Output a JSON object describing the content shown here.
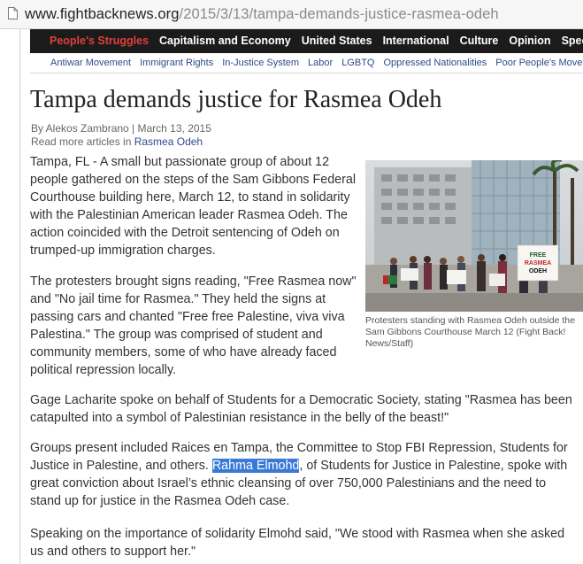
{
  "browser": {
    "url_host": "www.fightbacknews.org",
    "url_path": "/2015/3/13/tampa-demands-justice-rasmea-odeh"
  },
  "nav": {
    "primary": [
      "People's Struggles",
      "Capitalism and Economy",
      "United States",
      "International",
      "Culture",
      "Opinion",
      "Special Co"
    ],
    "active_index": 0,
    "secondary": [
      "Antiwar Movement",
      "Immigrant Rights",
      "In-Justice System",
      "Labor",
      "LGBTQ",
      "Oppressed Nationalities",
      "Poor People's Move"
    ]
  },
  "article": {
    "title": "Tampa demands justice for Rasmea Odeh",
    "byline": "By Alekos Zambrano | March 13, 2015",
    "read_more_prefix": "Read more articles in ",
    "read_more_link": "Rasmea Odeh",
    "paragraphs": [
      "Tampa, FL - A small but passionate group of about 12 people gathered on the steps of the Sam Gibbons Federal Courthouse building here, March 12, to stand in solidarity with the Palestinian American leader Rasmea Odeh. The action coincided with the Detroit sentencing of Odeh on trumped-up immigration charges.",
      "The protesters brought signs reading, \"Free Rasmea now\" and \"No jail time for Rasmea.\" They held the signs at passing cars and chanted \"Free free Palestine, viva viva Palestina.\" The group was comprised of student and community members, some of who have already faced political repression locally.",
      "Gage Lacharite spoke on behalf of Students for a Democratic Society, stating \"Rasmea has been catapulted into a symbol of Palestinian resistance in the belly of the beast!\""
    ],
    "para4_before": "Groups present included Raices en Tampa, the Committee to Stop FBI Repression, Students for Justice in Palestine, and others. ",
    "para4_highlight": "Rahma Elmohd",
    "para4_after": ", of Students for Justice in Palestine, spoke with great conviction about Israel’s ethnic cleansing of over 750,000 Palestinians and the need to stand up for justice in the Rasmea Odeh case.",
    "para5": "Speaking on the importance of solidarity Elmohd said, \"We stood with Rasmea when she asked us and others to support her.\"",
    "photo": {
      "caption": "Protesters standing with Rasmea Odeh outside the Sam Gibbons Courthouse March 12 (Fight Back! News/Staff)",
      "sign_1": "FREE RASMEA ODEH"
    }
  },
  "colors": {
    "nav_bg": "#1b1b1b",
    "nav_active": "#e0403a",
    "link": "#2b4b8a",
    "highlight": "#3a79d6"
  }
}
